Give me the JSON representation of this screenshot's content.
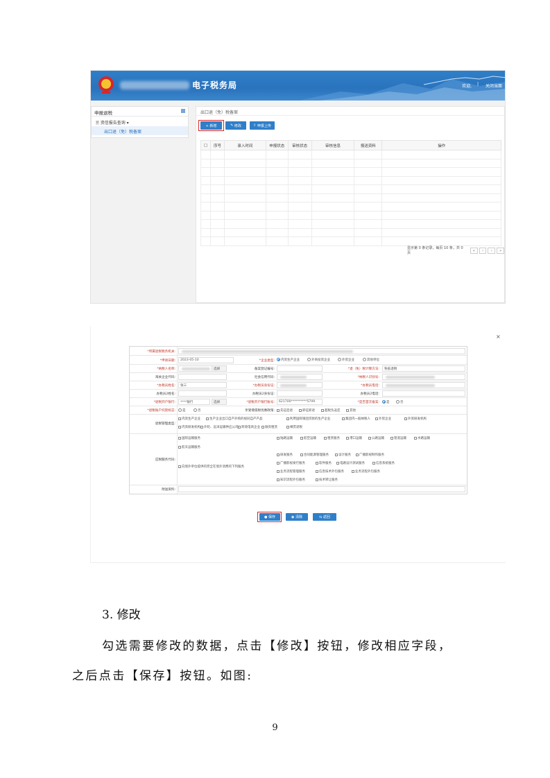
{
  "screenshot1": {
    "banner": {
      "title": "电子税务局",
      "welcome": "欢迎,",
      "separator": "|",
      "close_link": "关闭当面"
    },
    "sidebar": {
      "header": "申报退税",
      "group": "资信报告查询 ▾",
      "item": "出口退（免）税备案"
    },
    "breadcrumb": "出口退（免）税备案",
    "toolbar": {
      "add": "+ 新增",
      "modify": "修改",
      "upload": "申报上传"
    },
    "table": {
      "columns": [
        "□",
        "序号",
        "录入时间",
        "申报状态",
        "审核状态",
        "审核信息",
        "报送资料",
        "操作"
      ],
      "empty_row_count": 11
    },
    "pager": {
      "summary": "显示第 0 条记录，每页 10 条，共 0 页",
      "buttons": [
        "«",
        "‹",
        "›",
        "»"
      ]
    }
  },
  "screenshot2": {
    "close": "×",
    "form": {
      "tax_authority_label": "*所属退税税务机关:",
      "apply_date_label": "*申请日期:",
      "apply_date_value": "2023-05-10",
      "enterprise_type_label": "*企业类型:",
      "enterprise_types": [
        "内资生产企业",
        "外商投资企业",
        "外贸企业",
        "其他单位"
      ],
      "taxpayer_name_label": "*纳税人名称:",
      "select_btn": "选择",
      "customs_code_label": "海关企业代码:",
      "credit_code_label": "社会信用代码:",
      "agent_name_label": "*办税员姓名:",
      "agent_name_value": "张三",
      "agent_id_label": "*办税员身份证:",
      "agent2_name_label": "办税员2姓名:",
      "agent2_id_label": "办税员2身份证:",
      "bank_label": "*退税开户银行:",
      "bank_value": "****银行",
      "account_label": "*退税开户银行账号:",
      "account_value": "621700**********5709",
      "filing_no_label": "备案登记编号:",
      "refund_method_label": "*退（免）税计算方法:",
      "refund_method_value": "免抵退税",
      "taxpayer_id_label": "*纳税人识别号:",
      "agent_phone_label": "*办税员电话:",
      "agent2_phone_label": "办税员2电话:",
      "first_filing_label": "*是否首次备案:",
      "yes": "是",
      "no": "否",
      "agent_flag_label": "*退税账户托管标志:",
      "special_label": "享受增值税优惠政策:",
      "special_options": [
        "先征后退",
        "即征即退",
        "超税负返还",
        "其他"
      ],
      "mgmt_type_label": "退税管理类型:",
      "mgmt_options": [
        "内资生产企业",
        "生产企业出口自产外购的视同自产产品",
        "利用国际银团贷款的生产企业",
        "集团内一般纳税人",
        "外贸企业",
        "外资研发机构",
        "内资研发机构",
        "外轮、远洋运输供应公司",
        "跨境电商企业",
        "融资租赁",
        "横贯退税"
      ],
      "service_code_label": "应税服务代码:",
      "service_left": [
        "国际运输服务",
        "航天运输服务",
        "向境外单位提供的完全在境外消费的下列服务"
      ],
      "service_right": [
        "陆路运输",
        "航空运输",
        "租赁服务",
        "港口运输",
        "公路运输",
        "管道运输",
        "水路运输",
        "研发服务",
        "合同能源管理服务",
        "设计服务",
        "广播影视制作服务",
        "广播影视发行服务",
        "软件服务",
        "电路设计测试服务",
        "信息系统服务",
        "业务流程管理服务",
        "信息技术外包服务",
        "业务流程外包服务",
        "知识流程外包服务",
        "技术转让服务"
      ],
      "attachments_label": "附送资料:"
    },
    "buttons": {
      "save": "保存",
      "clear": "清除",
      "back": "返回"
    }
  },
  "body": {
    "section_title": "3. 修改",
    "paragraph_1": "勾选需要修改的数据，点击【修改】按钮，修改相应字段，",
    "paragraph_2": "之后点击【保存】按钮。如图:",
    "page_number": "9"
  },
  "colors": {
    "banner_blue": "#2f7fc8",
    "highlight_red": "#d9252a",
    "required_red": "#c0392b"
  }
}
